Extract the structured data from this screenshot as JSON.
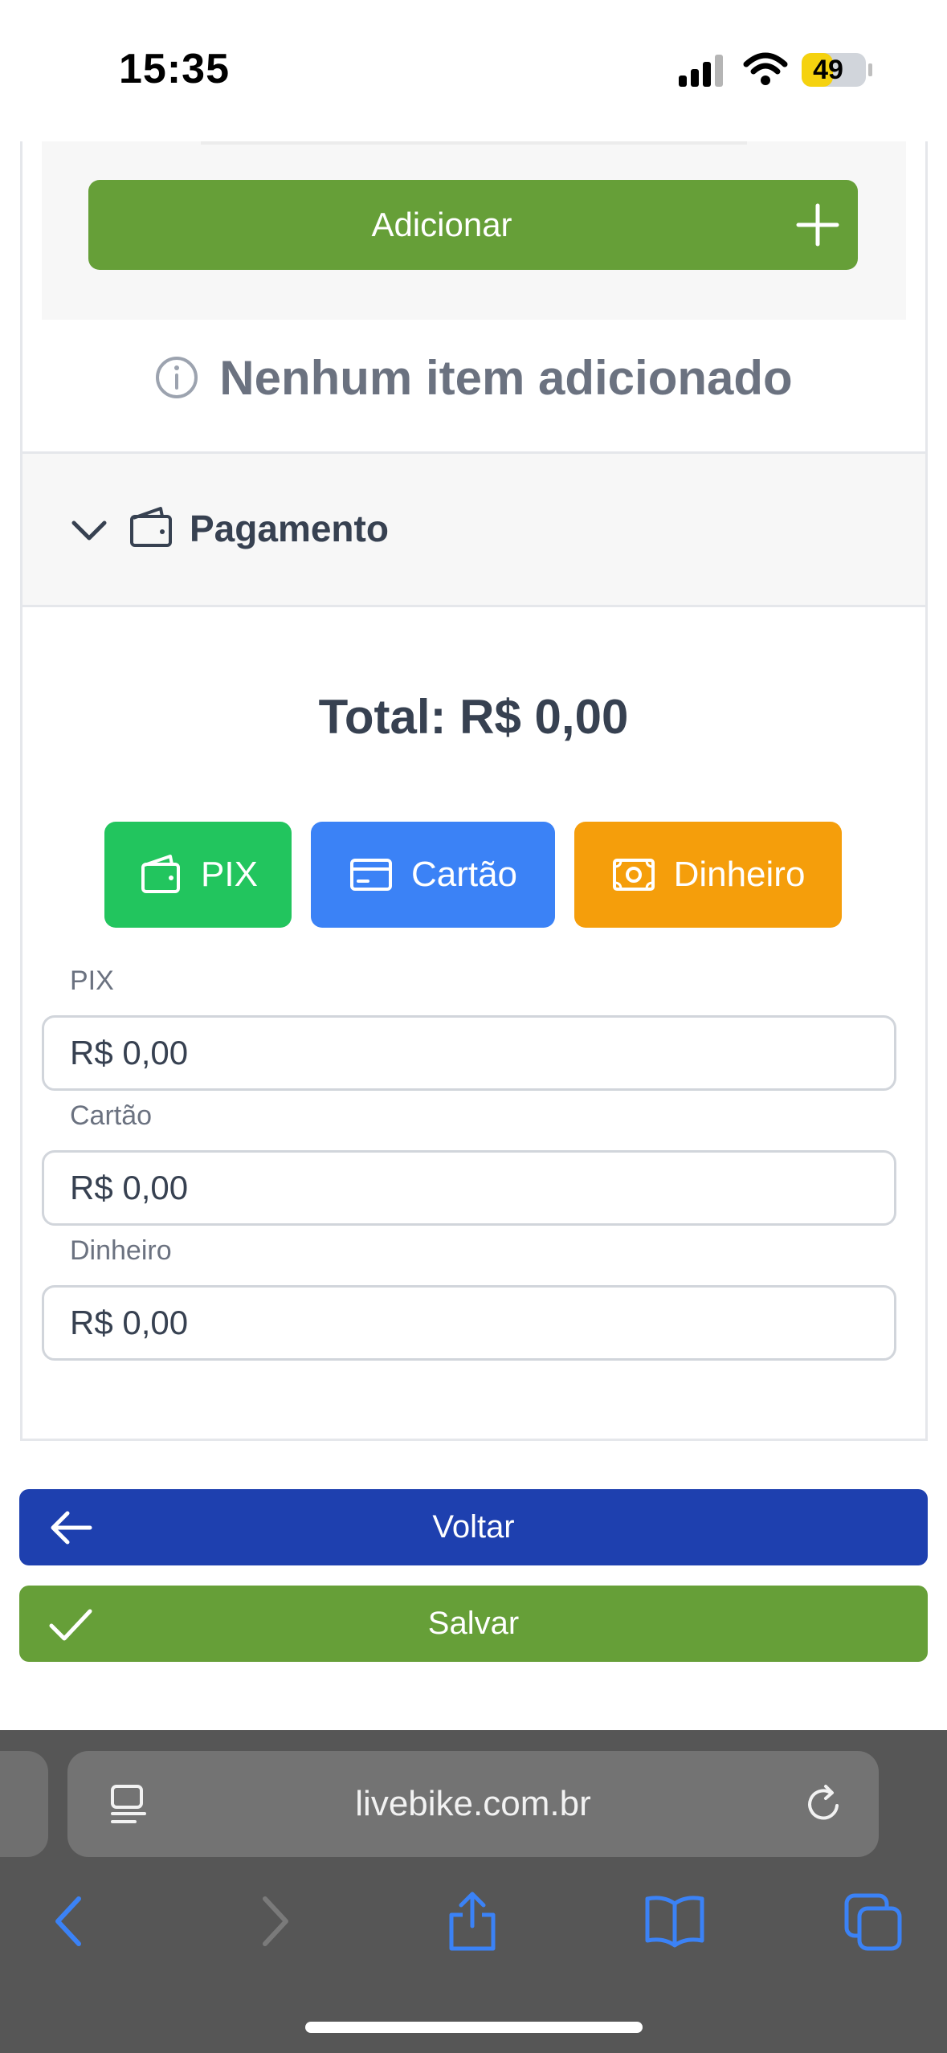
{
  "status_bar": {
    "time": "15:35",
    "battery": "49",
    "battery_level": 0.49
  },
  "items": {
    "add_label": "Adicionar",
    "empty_message": "Nenhum item adicionado"
  },
  "payment": {
    "section_title": "Pagamento",
    "total_text": "Total: R$ 0,00",
    "methods": [
      {
        "label": "PIX",
        "color": "#22c55e"
      },
      {
        "label": "Cartão",
        "color": "#3b82f6"
      },
      {
        "label": "Dinheiro",
        "color": "#f59e0b"
      }
    ],
    "fields": [
      {
        "label": "PIX",
        "value": "R$ 0,00"
      },
      {
        "label": "Cartão",
        "value": "R$ 0,00"
      },
      {
        "label": "Dinheiro",
        "value": "R$ 0,00"
      }
    ]
  },
  "actions": {
    "back_label": "Voltar",
    "back_color": "#1e40af",
    "save_label": "Salvar",
    "save_color": "#669f38"
  },
  "browser": {
    "url": "livebike.com.br",
    "accent": "#3b82f6"
  }
}
